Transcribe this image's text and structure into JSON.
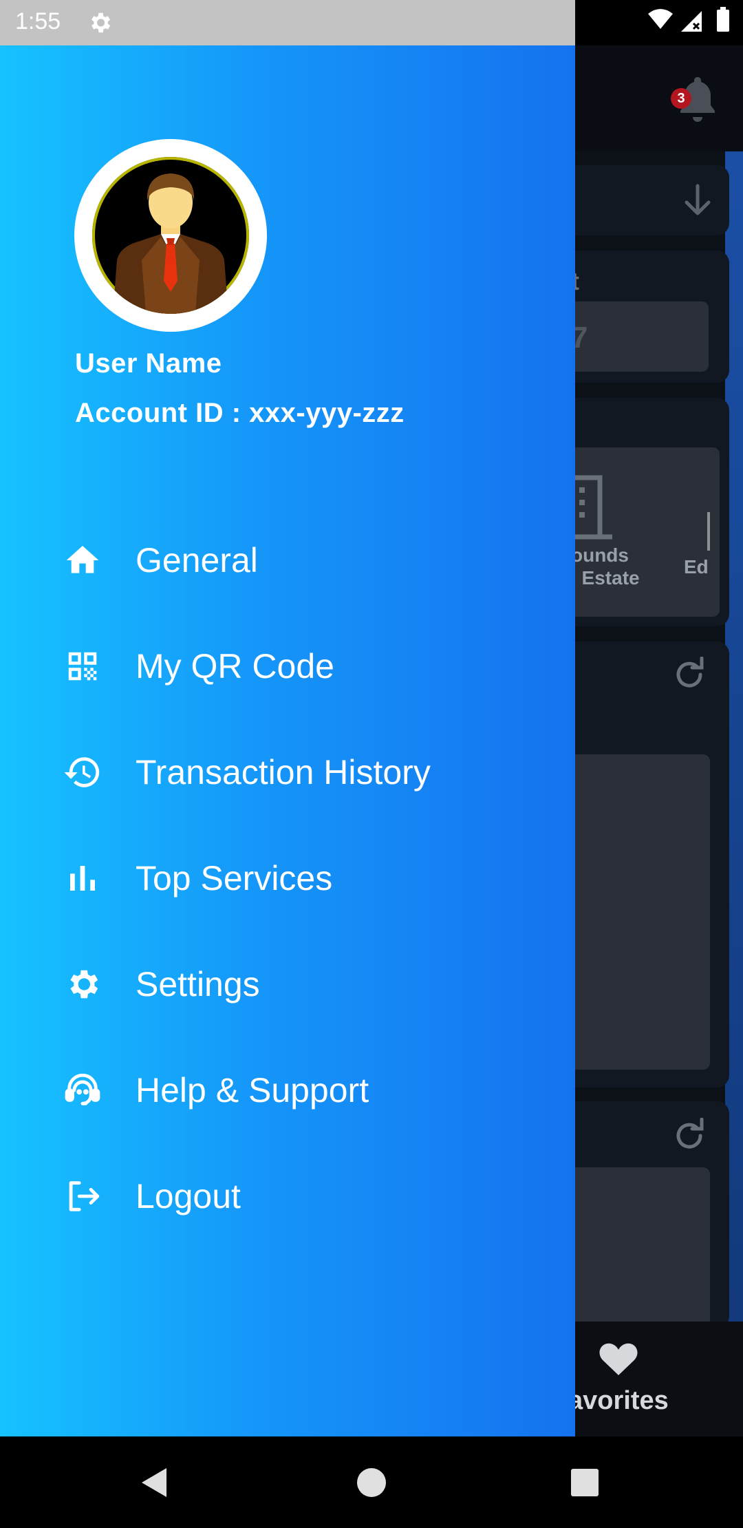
{
  "status_bar": {
    "time": "1:55"
  },
  "background": {
    "notification_count": "3",
    "category_line1": "ounds",
    "category_line2": "l Estate",
    "category_partial": "Ed",
    "partial_letter": "t",
    "partial_digit": "7",
    "bottom_tab_label": "avorites"
  },
  "drawer": {
    "user_name": "User Name",
    "account_id": "Account ID : xxx-yyy-zzz",
    "menu": [
      {
        "label": "General",
        "icon": "home-icon"
      },
      {
        "label": "My QR Code",
        "icon": "qr-code-icon"
      },
      {
        "label": "Transaction History",
        "icon": "history-icon"
      },
      {
        "label": "Top Services",
        "icon": "bar-chart-icon"
      },
      {
        "label": "Settings",
        "icon": "gear-icon"
      },
      {
        "label": "Help & Support",
        "icon": "support-agent-icon"
      },
      {
        "label": "Logout",
        "icon": "logout-icon"
      }
    ]
  },
  "colors": {
    "drawer_gradient_start": "#16c2ff",
    "drawer_gradient_end": "#1572ef",
    "badge": "#b3161f"
  }
}
